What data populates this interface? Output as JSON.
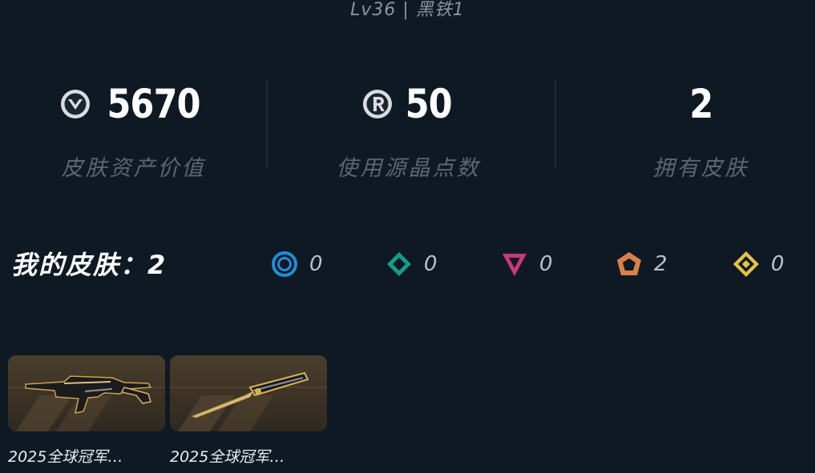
{
  "header": {
    "level_text": "Lv36 | 黑铁1"
  },
  "stats": [
    {
      "value": "5670",
      "label": "皮肤资产价值",
      "icon": "valorant-points-icon"
    },
    {
      "value": "50",
      "label": "使用源晶点数",
      "icon": "radianite-points-icon"
    },
    {
      "value": "2",
      "label": "拥有皮肤",
      "icon": ""
    }
  ],
  "skins": {
    "title": "我的皮肤：2",
    "tiers": [
      {
        "icon": "select-tier-icon",
        "color": "#1e8fd8",
        "count": "0"
      },
      {
        "icon": "deluxe-tier-icon",
        "color": "#169b8a",
        "count": "0"
      },
      {
        "icon": "premium-tier-icon",
        "color": "#c8397a",
        "count": "0"
      },
      {
        "icon": "exclusive-tier-icon",
        "color": "#d9804a",
        "count": "2"
      },
      {
        "icon": "ultra-tier-icon",
        "color": "#e6c246",
        "count": "0"
      }
    ],
    "items": [
      {
        "name": "2025全球冠军…",
        "icon": "rifle-skin-icon"
      },
      {
        "name": "2025全球冠军…",
        "icon": "knife-skin-icon"
      }
    ]
  }
}
